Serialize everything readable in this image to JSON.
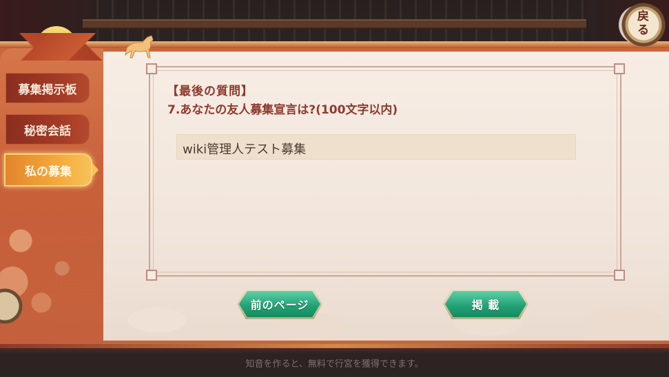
{
  "sidebar": {
    "tabs": [
      {
        "label": "募集掲示板",
        "active": false
      },
      {
        "label": "秘密会話",
        "active": false
      },
      {
        "label": "私の募集",
        "active": true
      }
    ]
  },
  "back_button": {
    "label": "戻る"
  },
  "question": {
    "title": "【最後の質問】",
    "text": "7.あなたの友人募集宣言は?(100文字以内)"
  },
  "answer": {
    "value": "wiki管理人テスト募集"
  },
  "buttons": {
    "prev_label": "前のページ",
    "post_label": "掲 載"
  },
  "footer": {
    "text": "知音を作ると、無料で行宮を獲得できます。"
  },
  "colors": {
    "accent_orange": "#f5a93a",
    "frame_red": "#c9663c",
    "question_text": "#8e3a2d",
    "button_green": "#24a377"
  }
}
